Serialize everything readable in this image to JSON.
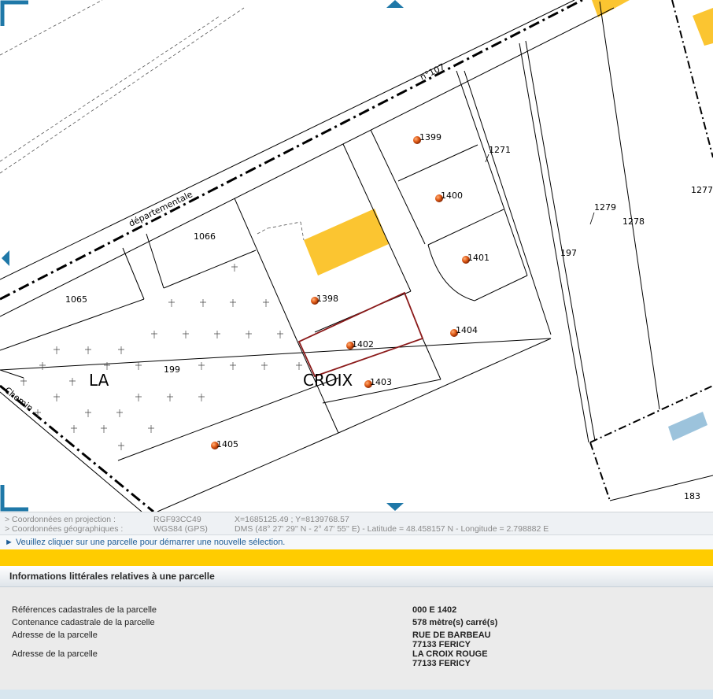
{
  "map": {
    "road_labels": {
      "dept": "départementale",
      "number": "n°107",
      "chemin": "Chemin"
    },
    "place_labels": {
      "la": "LA",
      "croix": "CROIX"
    },
    "parcels": [
      "1399",
      "1271",
      "1400",
      "1401",
      "1398",
      "1402",
      "1403",
      "1404",
      "1405",
      "1066",
      "1065",
      "199",
      "197",
      "1279",
      "1278",
      "1277",
      "183"
    ],
    "colors": {
      "building": "#fbc531",
      "water": "#9cc3dc",
      "selected_outline": "#8b1a1a",
      "marker": "#e05a16",
      "nav_arrow": "#1f78a8"
    }
  },
  "coordinates": {
    "projection_label": "> Coordonnées en projection :",
    "projection_system": "RGF93CC49",
    "projection_value": "X=1685125.49 ; Y=8139768.57",
    "geo_label": "> Coordonnées géographiques :",
    "geo_system": "WGS84 (GPS)",
    "geo_value": "DMS (48° 27' 29'' N - 2° 47' 55'' E) - Latitude = 48.458157 N - Longitude = 2.798882 E"
  },
  "hint": "► Veuillez cliquer sur une parcelle pour démarrer une nouvelle sélection.",
  "panel": {
    "title": "Informations littérales relatives à une parcelle",
    "rows": [
      {
        "label": "Références cadastrales de la parcelle",
        "value": "000 E 1402"
      },
      {
        "label": "Contenance cadastrale de la parcelle",
        "value": "578 mètre(s) carré(s)"
      },
      {
        "label": "Adresse de la parcelle",
        "value_line1": "RUE DE BARBEAU",
        "value_line2": "77133 FERICY"
      },
      {
        "label": "Adresse de la parcelle",
        "value_line1": "LA CROIX ROUGE",
        "value_line2": "77133 FERICY"
      }
    ]
  }
}
